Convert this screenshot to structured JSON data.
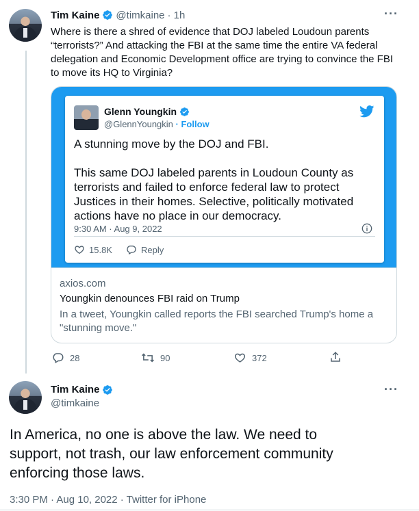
{
  "tweet1": {
    "name": "Tim Kaine",
    "handle": "@timkaine",
    "time": "· 1h",
    "text_lines": [
      "Where is there a shred of evidence that DOJ labeled Loudoun parents",
      "“terrorists?” And attacking the FBI at the same time the entire VA federal",
      "delegation and Economic Development office are trying to convince the FBI",
      "to move its HQ to Virginia?"
    ],
    "card": {
      "embed": {
        "name": "Glenn Youngkin",
        "handle": "@GlennYoungkin",
        "follow": "· Follow",
        "text_lines": [
          "A stunning move by the DOJ and FBI.",
          "",
          "This same DOJ labeled parents in Loudoun County as",
          "terrorists and failed to enforce federal law to protect",
          "Justices in their homes. Selective, politically motivated",
          "actions have no place in our democracy."
        ],
        "timestamp": "9:30 AM · Aug 9, 2022",
        "likes": "15.8K",
        "reply_label": "Reply"
      },
      "domain": "axios.com",
      "title": "Youngkin denounces FBI raid on Trump",
      "description_lines": [
        "In a tweet, Youngkin called reports the FBI searched Trump's home a",
        "\"stunning move.\""
      ]
    },
    "replies": "28",
    "retweets": "90",
    "likes": "372"
  },
  "tweet2": {
    "name": "Tim Kaine",
    "handle": "@timkaine",
    "text_lines": [
      "In America, no one is above the law. We need to",
      "support, not trash, our law enforcement community",
      "enforcing those laws."
    ],
    "timestamp": "3:30 PM · Aug 10, 2022 · Twitter for iPhone"
  },
  "colors": {
    "brand_blue": "#1d9bf0",
    "muted": "#536471",
    "border": "#cfd9de"
  }
}
